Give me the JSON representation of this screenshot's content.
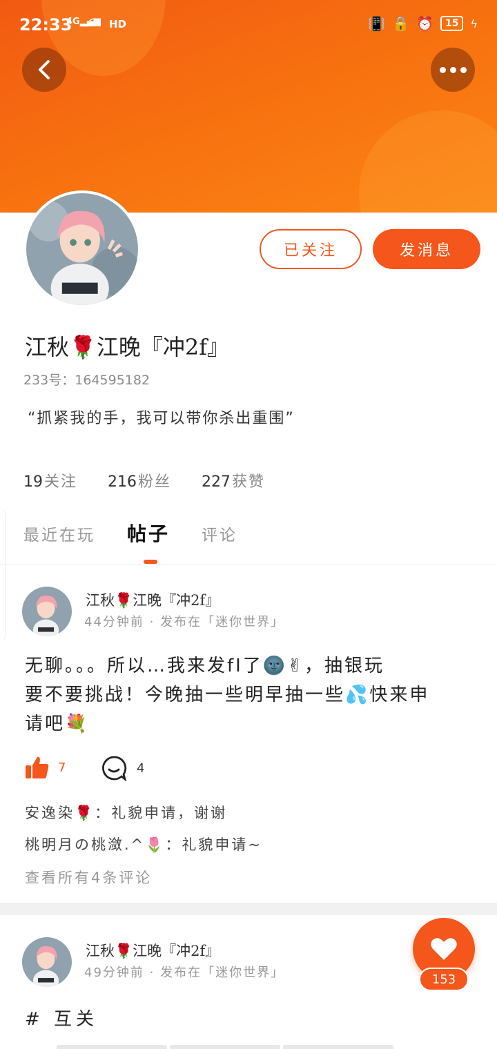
{
  "status_bar": {
    "time": "22:33",
    "network": "4G",
    "hd": "HD",
    "battery": "15"
  },
  "header": {
    "back_icon": "chevron-left-icon",
    "more_icon": "more-dots-icon"
  },
  "profile": {
    "name": "江秋🌹江晚『冲2f』",
    "uid": "233号：164595182",
    "bio": "“抓紧我的手，我可以带你杀出重围”",
    "follow_label": "已关注",
    "message_label": "发消息",
    "stats": [
      {
        "num": "19",
        "label": "关注"
      },
      {
        "num": "216",
        "label": "粉丝"
      },
      {
        "num": "227",
        "label": "获赞"
      }
    ]
  },
  "tabs": [
    {
      "label": "最近在玩",
      "active": false
    },
    {
      "label": "帖子",
      "active": true
    },
    {
      "label": "评论",
      "active": false
    }
  ],
  "posts": [
    {
      "author": "江秋🌹江晚『冲2f』",
      "meta": "44分钟前 · 发布在「迷你世界」",
      "text_line1": "无聊。。。所以…我来发fI了🌚✌，抽银玩",
      "text_line2": "要不要挑战！今晚抽一些明早抽一些💦快来申",
      "text_line3": "请吧💐",
      "likes": "7",
      "comments": "4",
      "comment_previews": [
        "安逸染🌹：礼貌申请，谢谢",
        "桃明月の桃潋.^🌷：礼貌申请~"
      ],
      "view_all": "查看所有4条评论"
    },
    {
      "author": "江秋🌹江晚『冲2f』",
      "meta": "49分钟前 · 发布在「迷你世界」",
      "text": "# 互关"
    }
  ],
  "fab": {
    "icon": "heart-icon",
    "count": "153"
  },
  "colors": {
    "accent": "#f4561b",
    "banner": "#f76f10"
  }
}
